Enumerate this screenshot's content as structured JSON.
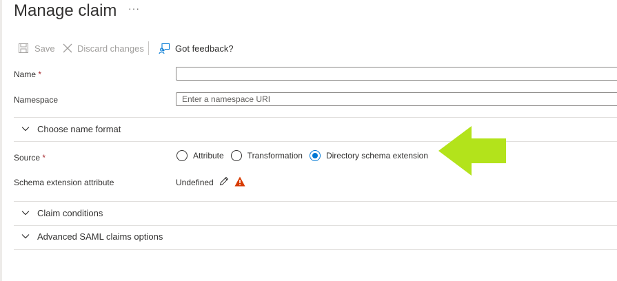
{
  "page": {
    "title": "Manage claim",
    "more": "···"
  },
  "toolbar": {
    "save": "Save",
    "discard": "Discard changes",
    "feedback": "Got feedback?"
  },
  "form": {
    "name": {
      "label": "Name",
      "required": "*",
      "value": "",
      "placeholder": ""
    },
    "namespace": {
      "label": "Namespace",
      "value": "",
      "placeholder": "Enter a namespace URI"
    },
    "name_format": {
      "label": "Choose name format",
      "expanded": false
    },
    "source": {
      "label": "Source",
      "required": "*",
      "options": [
        "Attribute",
        "Transformation",
        "Directory schema extension"
      ],
      "selected": "Directory schema extension"
    },
    "schema_extension": {
      "label": "Schema extension attribute",
      "value": "Undefined"
    },
    "claim_conditions": {
      "label": "Claim conditions",
      "expanded": false
    },
    "advanced_saml": {
      "label": "Advanced SAML claims options",
      "expanded": false
    }
  },
  "colors": {
    "accent": "#0078d4",
    "required": "#a4262c",
    "warning": "#d83b01",
    "highlight_arrow": "#b3e31b"
  },
  "icons": [
    "save-icon",
    "close-icon",
    "feedback-icon",
    "chevron-down-icon",
    "pencil-icon",
    "warning-icon",
    "arrow-left-icon"
  ]
}
